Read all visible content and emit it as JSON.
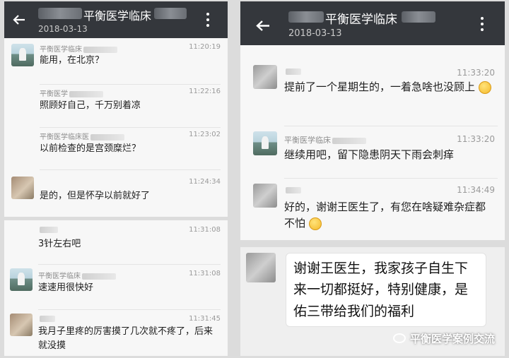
{
  "screenshot_left": {
    "header": {
      "title": "平衡医学临床",
      "date": "2018-03-13",
      "back_icon": "back-arrow-icon",
      "menu_icon": "more-vertical-icon"
    },
    "messages": [
      {
        "name": "平衡医学临床",
        "time": "11:20:19",
        "text": "能用，在北京？",
        "avatar": "doctor"
      },
      {
        "name": "平衡医学",
        "time": "11:22:16",
        "text": "照顾好自己，千万别着凉",
        "avatar": "none"
      },
      {
        "name": "平衡医学临床医",
        "time": "11:23:02",
        "text": "以前检查的是宫颈糜烂？",
        "avatar": "none"
      },
      {
        "name": "",
        "time": "11:24:34",
        "text": "是的，但是怀孕以前就好了",
        "avatar": "patient"
      }
    ],
    "more_messages": [
      {
        "name": "",
        "time": "11:31:08",
        "text": "3针左右吧",
        "avatar": "none"
      },
      {
        "name": "平衡医学临床",
        "time": "11:31:08",
        "text": "速速用很快好",
        "avatar": "doctor"
      },
      {
        "name": "",
        "time": "11:31:45",
        "text": "我月子里疼的厉害摸了几次就不疼了，后来就没摸",
        "avatar": "patient"
      }
    ]
  },
  "screenshot_right": {
    "header": {
      "title": "平衡医学临床",
      "date": "2018-03-13",
      "back_icon": "back-arrow-icon",
      "menu_icon": "more-vertical-icon"
    },
    "messages": [
      {
        "name": "",
        "time": "11:33:20",
        "text": "提前了一个星期生的，一着急啥也没顾上",
        "emoji": "laughing-emoji",
        "avatar": "grey"
      },
      {
        "name": "平衡医学临床",
        "time": "11:33:20",
        "text": "继续用吧，留下隐患阴天下雨会刺痒",
        "avatar": "doctor"
      },
      {
        "name": "",
        "time": "11:34:49",
        "text": "好的，谢谢王医生了，有您在啥疑难杂症都不怕",
        "emoji": "smile-emoji",
        "avatar": "grey"
      }
    ]
  },
  "big_message": {
    "text": "谢谢王医生，我家孩子自生下来一切都挺好，特别健康，是佑三带给我们的福利",
    "avatar": "grey"
  },
  "watermark": {
    "text": "平衡医学案例交流",
    "icon": "wechat-icon"
  },
  "colors": {
    "header_bg": "#34373c",
    "panel_bg": "#f7f7f7",
    "page_bg": "#dcdcdc"
  }
}
